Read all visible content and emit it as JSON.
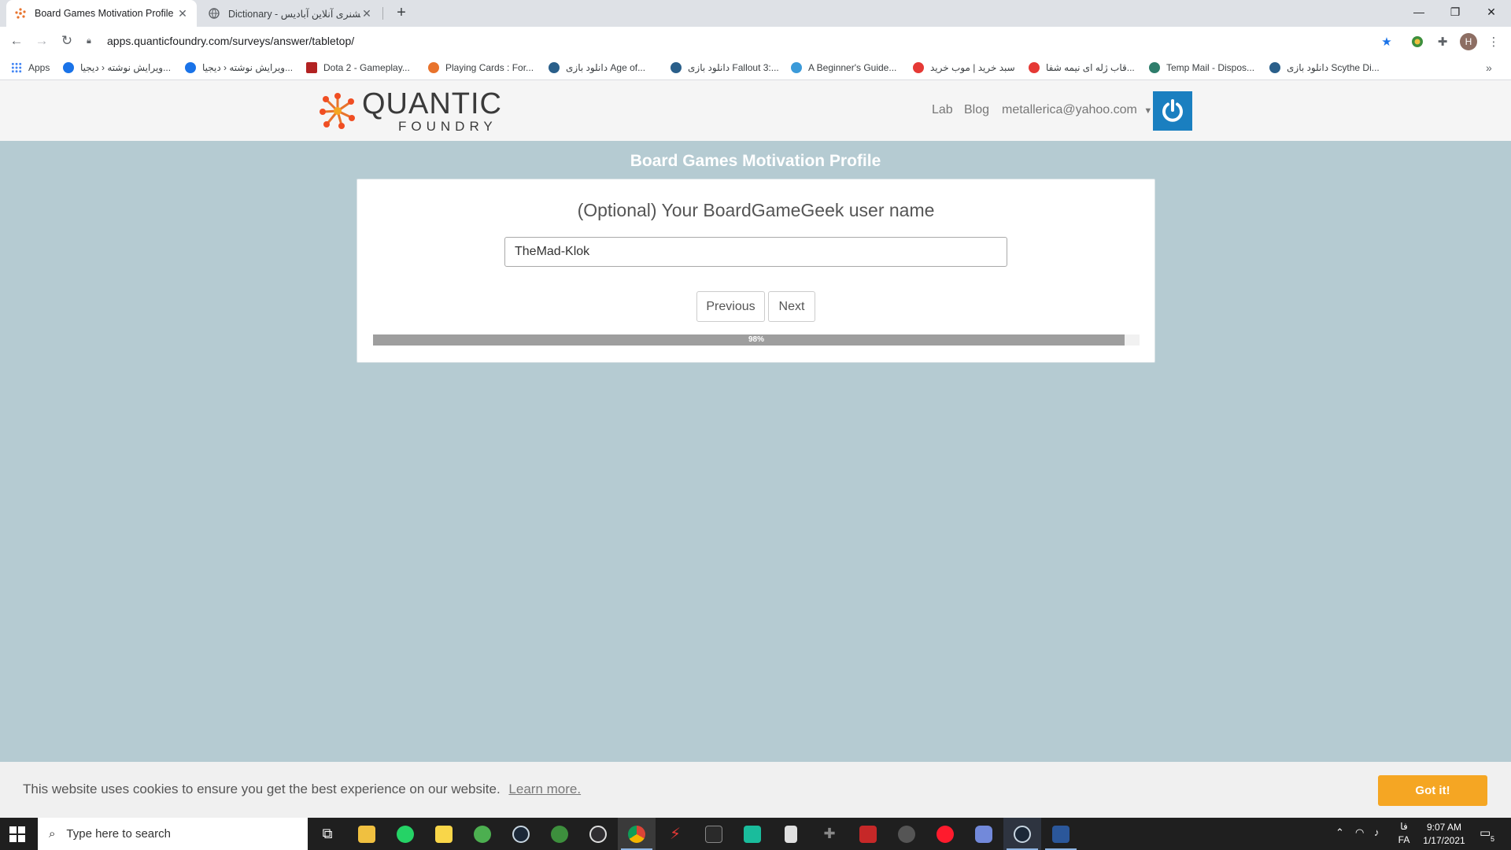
{
  "browser": {
    "tabs": [
      {
        "title": "Board Games Motivation Profile",
        "active": true
      },
      {
        "title": "Dictionary - دیکشنری آنلاین آبادیس",
        "active": false
      }
    ],
    "new_tab": "+",
    "url": "apps.quanticfoundry.com/surveys/answer/tabletop/",
    "profile_initial": "H",
    "bookmarks": [
      {
        "label": "Apps",
        "color": "#4285f4"
      },
      {
        "label": "ویرایش نوشته ‹ دیجیا...",
        "color": "#1a73e8"
      },
      {
        "label": "ویرایش نوشته ‹ دیجیا...",
        "color": "#1a73e8"
      },
      {
        "label": "Dota 2 - Gameplay...",
        "color": "#b22222"
      },
      {
        "label": "Playing Cards : For...",
        "color": "#e8732c"
      },
      {
        "label": "دانلود بازی Age of...",
        "color": "#2a5f8a"
      },
      {
        "label": "دانلود بازی Fallout 3:...",
        "color": "#2a5f8a"
      },
      {
        "label": "A Beginner's Guide...",
        "color": "#3b9ad9"
      },
      {
        "label": "سبد خرید | موب خرید",
        "color": "#e53935"
      },
      {
        "label": "قاب ژله ای نیمه شفا...",
        "color": "#e53935"
      },
      {
        "label": "Temp Mail - Dispos...",
        "color": "#2e7d6b"
      },
      {
        "label": "دانلود بازی Scythe Di...",
        "color": "#2a5f8a"
      }
    ]
  },
  "site": {
    "logo_line1": "QUANTIC",
    "logo_line2": "FOUNDRY",
    "nav": {
      "lab": "Lab",
      "blog": "Blog",
      "account": "metallerica@yahoo.com"
    }
  },
  "survey": {
    "title": "Board Games Motivation Profile",
    "question": "(Optional) Your BoardGameGeek user name",
    "answer_value": "TheMad-Klok",
    "prev_label": "Previous",
    "next_label": "Next",
    "progress_percent": 98,
    "progress_label": "98%"
  },
  "cookie": {
    "message": "This website uses cookies to ensure you get the best experience on our website.",
    "learn_more": "Learn more.",
    "accept": "Got it!"
  },
  "taskbar": {
    "search_placeholder": "Type here to search",
    "lang_top": "فا",
    "lang": "FA",
    "time": "9:07 AM",
    "date": "1/17/2021",
    "notifications": "5"
  }
}
